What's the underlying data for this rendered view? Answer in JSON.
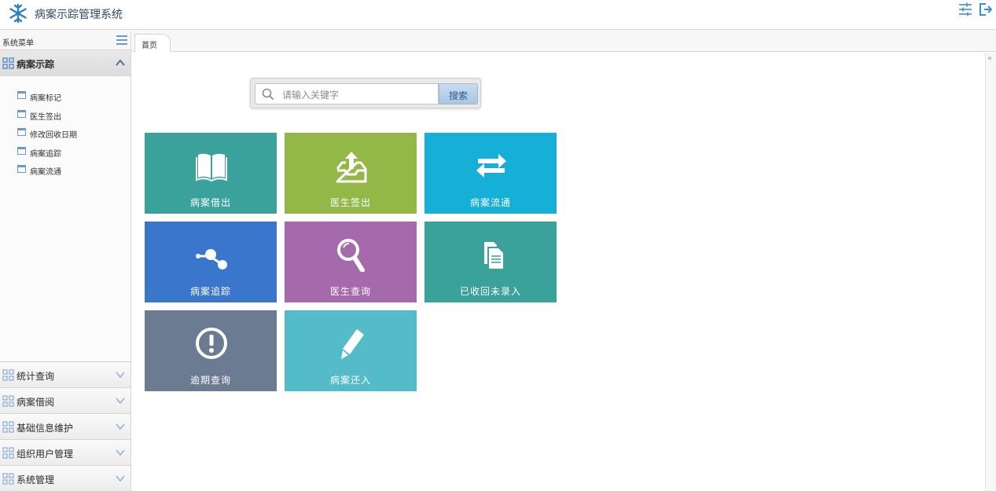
{
  "header": {
    "app_title": "病案示踪管理系统",
    "logo_icon": "snowflake-logo-icon",
    "settings_icon": "sliders-icon",
    "logout_icon": "logout-icon"
  },
  "sidebar": {
    "title": "系统菜单",
    "groups": [
      {
        "label": "病案示踪",
        "expanded": true,
        "items": [
          "病案标记",
          "医生签出",
          "修改回收日期",
          "病案追踪",
          "病案流通"
        ]
      },
      {
        "label": "统计查询",
        "expanded": false
      },
      {
        "label": "病案借阅",
        "expanded": false
      },
      {
        "label": "基础信息维护",
        "expanded": false
      },
      {
        "label": "组织用户管理",
        "expanded": false
      },
      {
        "label": "系统管理",
        "expanded": false
      }
    ]
  },
  "tabs": {
    "home": "首页"
  },
  "right_strip": {
    "collapse": "«"
  },
  "search": {
    "placeholder": "请输入关键字",
    "button": "搜索"
  },
  "tiles": [
    {
      "label": "病案借出",
      "color": "#3aa19b",
      "icon": "open-book-icon"
    },
    {
      "label": "医生签出",
      "color": "#93b847",
      "icon": "upload-tray-icon"
    },
    {
      "label": "病案流通",
      "color": "#15afd8",
      "icon": "swap-arrows-icon"
    },
    {
      "label": "病案追踪",
      "color": "#3a76cb",
      "icon": "nodes-icon"
    },
    {
      "label": "医生查询",
      "color": "#a46aab",
      "icon": "magnifier-icon"
    },
    {
      "label": "已收回未录入",
      "color": "#3aa19b",
      "icon": "documents-icon"
    },
    {
      "label": "逾期查询",
      "color": "#6b7b92",
      "icon": "exclamation-icon"
    },
    {
      "label": "病案还入",
      "color": "#54bcc9",
      "icon": "pencil-icon"
    }
  ]
}
